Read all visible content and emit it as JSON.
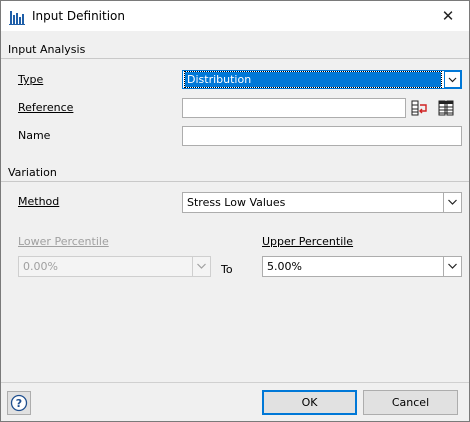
{
  "window": {
    "title": "Input Definition",
    "close_glyph": "✕"
  },
  "sections": {
    "input_analysis": "Input Analysis",
    "variation": "Variation"
  },
  "type": {
    "label": "Type",
    "value": "Distribution"
  },
  "reference": {
    "label": "Reference",
    "value": ""
  },
  "name": {
    "label": "Name",
    "value": ""
  },
  "method": {
    "label": "Method",
    "value": "Stress Low Values"
  },
  "lower": {
    "label": "Lower Percentile",
    "value": "0.00%"
  },
  "to_label": "To",
  "upper": {
    "label": "Upper Percentile",
    "value": "5.00%"
  },
  "buttons": {
    "ok": "OK",
    "cancel": "Cancel"
  },
  "icons": {
    "app": "bar-chart-icon",
    "reference_select": "cell-reference-icon",
    "reference_grid": "grid-icon",
    "help": "help-icon"
  },
  "colors": {
    "accent": "#0078d7",
    "disabled_text": "#a0a0a0"
  }
}
